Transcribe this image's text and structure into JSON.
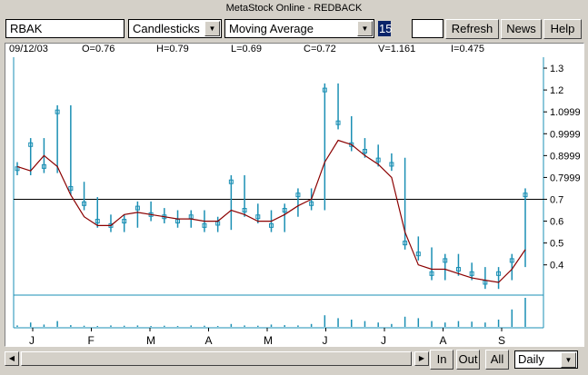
{
  "window": {
    "title": "MetaStock Online - REDBACK"
  },
  "toolbar": {
    "symbol": "RBAK",
    "chart_style": "Candlesticks",
    "indicator": "Moving Average",
    "period": "15",
    "refresh_label": "Refresh",
    "news_label": "News",
    "help_label": "Help"
  },
  "quote": {
    "date": "09/12/03",
    "open": "O=0.76",
    "high": "H=0.79",
    "low": "L=0.69",
    "close": "C=0.72",
    "volume": "V=1.161",
    "indicator": "I=0.475"
  },
  "navigation": {
    "in_label": "In",
    "out_label": "Out",
    "all_label": "All",
    "timeframe": "Daily"
  },
  "colors": {
    "price": "#1a8fb4",
    "moving_average": "#8b0000",
    "grid_line": "#000000",
    "panel_border": "#1a8fb4"
  },
  "icons": {
    "dropdown": "chevron-down-icon",
    "scroll_left": "arrow-left-icon",
    "scroll_right": "arrow-right-icon"
  },
  "chart_data": {
    "type": "line",
    "title": "",
    "xlabel": "",
    "ylabel": "",
    "x_tick_labels": [
      "J",
      "F",
      "M",
      "A",
      "M",
      "J",
      "J",
      "A",
      "S"
    ],
    "y_tick_labels": [
      "1.3",
      "1.2",
      "1.0999",
      "0.9999",
      "0.8999",
      "0.7999",
      "0.7",
      "0.6",
      "0.5",
      "0.4"
    ],
    "y_ticks": [
      1.3,
      1.2,
      1.0999,
      0.9999,
      0.8999,
      0.7999,
      0.7,
      0.6,
      0.5,
      0.4
    ],
    "ylim": [
      0.27,
      1.35
    ],
    "reference_line": 0.7,
    "x": [
      "J",
      "J",
      "J",
      "J",
      "J",
      "F",
      "F",
      "F",
      "F",
      "M",
      "M",
      "M",
      "M",
      "M",
      "A",
      "A",
      "A",
      "A",
      "M",
      "M",
      "M",
      "M",
      "J",
      "J",
      "J",
      "J",
      "J",
      "J",
      "J",
      "J",
      "J",
      "A",
      "A",
      "A",
      "A",
      "A",
      "S",
      "S",
      "S"
    ],
    "series": [
      {
        "name": "Price",
        "values": [
          0.84,
          0.95,
          0.85,
          1.1,
          0.75,
          0.68,
          0.6,
          0.58,
          0.6,
          0.66,
          0.63,
          0.62,
          0.6,
          0.62,
          0.58,
          0.59,
          0.78,
          0.65,
          0.62,
          0.58,
          0.65,
          0.72,
          0.68,
          1.2,
          1.05,
          0.95,
          0.92,
          0.88,
          0.86,
          0.5,
          0.45,
          0.36,
          0.42,
          0.38,
          0.36,
          0.32,
          0.36,
          0.42,
          0.72
        ]
      },
      {
        "name": "Moving Average",
        "values": [
          0.85,
          0.83,
          0.9,
          0.85,
          0.72,
          0.62,
          0.58,
          0.58,
          0.63,
          0.64,
          0.63,
          0.62,
          0.61,
          0.61,
          0.6,
          0.6,
          0.65,
          0.63,
          0.6,
          0.6,
          0.63,
          0.67,
          0.7,
          0.87,
          0.97,
          0.95,
          0.9,
          0.86,
          0.8,
          0.55,
          0.4,
          0.38,
          0.38,
          0.36,
          0.34,
          0.33,
          0.32,
          0.38,
          0.47
        ]
      }
    ],
    "volume": [
      0.05,
      0.15,
      0.08,
      0.2,
      0.06,
      0.04,
      0.03,
      0.05,
      0.04,
      0.05,
      0.03,
      0.04,
      0.03,
      0.05,
      0.04,
      0.03,
      0.1,
      0.05,
      0.04,
      0.08,
      0.06,
      0.05,
      0.1,
      0.4,
      0.3,
      0.25,
      0.2,
      0.15,
      0.1,
      0.35,
      0.3,
      0.2,
      0.15,
      0.2,
      0.18,
      0.15,
      0.25,
      0.6,
      1.0
    ],
    "grid": false,
    "legend": "none"
  }
}
